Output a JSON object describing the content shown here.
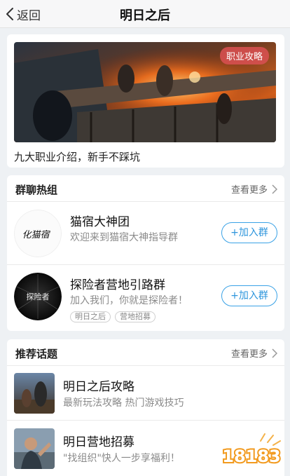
{
  "nav": {
    "back_label": "返回",
    "title": "明日之后"
  },
  "banner": {
    "tag": "职业攻略",
    "caption": "九大职业介绍，新手不踩坑"
  },
  "groups": {
    "title": "群聊热组",
    "more_label": "查看更多",
    "items": [
      {
        "name": "猫宿大神团",
        "desc": "欢迎来到猫宿大神指导群",
        "avatar_text": "化猫宿",
        "join_label": "+加入群",
        "tags": []
      },
      {
        "name": "探险者营地引路群",
        "desc": "加入我们，你就是探险者！",
        "avatar_text": "探险者",
        "join_label": "+加入群",
        "tags": [
          "明日之后",
          "营地招募"
        ]
      }
    ]
  },
  "topics": {
    "title": "推荐话题",
    "more_label": "查看更多",
    "items": [
      {
        "name": "明日之后攻略",
        "desc": "最新玩法攻略 热门游戏技巧"
      },
      {
        "name": "明日营地招募",
        "desc": "\"找组织\"快人一步享福利！"
      }
    ]
  },
  "watermark": "18183",
  "colors": {
    "accent_blue": "#2d95dc",
    "tag_red": "#d65050",
    "background": "#eef1f4"
  }
}
